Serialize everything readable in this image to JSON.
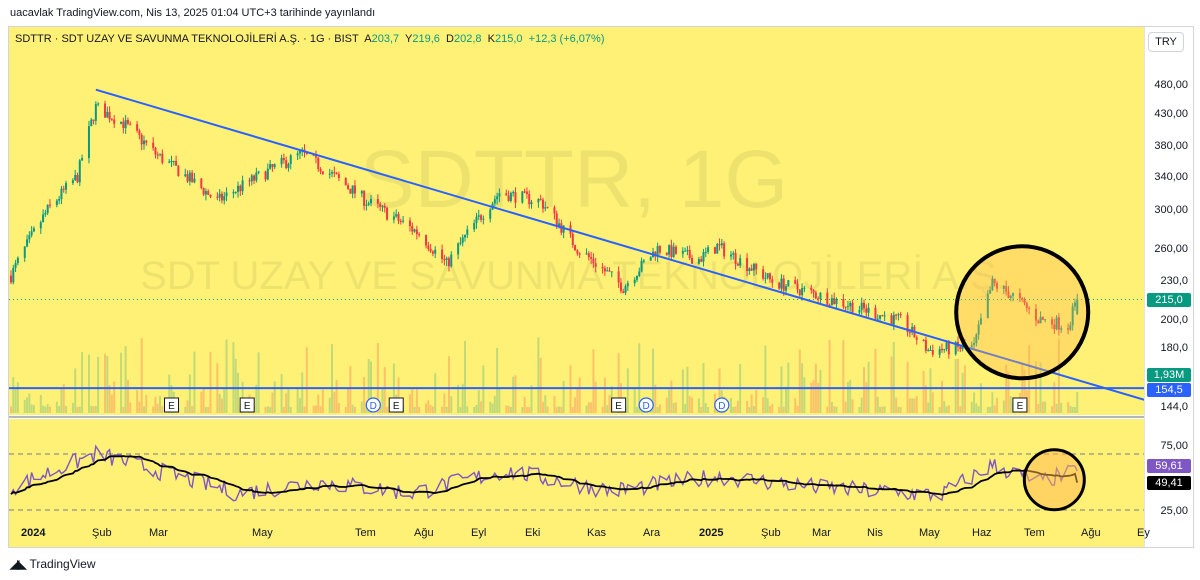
{
  "header": {
    "published": "uacavlak TradingView.com, Nis 13, 2025 01:04 UTC+3 tarihinde yayınlandı"
  },
  "legend": {
    "title": "SDTTR · SDT UZAY VE SAVUNMA TEKNOLOJİLERİ A.Ş. · 1G · BIST",
    "open_label": "A",
    "open": "203,7",
    "high_label": "Y",
    "high": "219,6",
    "low_label": "D",
    "low": "202,8",
    "close_label": "K",
    "close": "215,0",
    "change": "+12,3 (+6,07%)"
  },
  "currency": "TRY",
  "watermark": {
    "line1": "SDTTR, 1G",
    "line2": "SDT UZAY VE SAVUNMA TEKNOLOJİLERİ A.Ş."
  },
  "price_axis": {
    "labels": [
      "480,00",
      "430,00",
      "380,00",
      "340,00",
      "300,00",
      "260,00",
      "230,0",
      "200,0",
      "180,0",
      "144,0"
    ],
    "current_price": "215,0",
    "volume_tag": "1,93M",
    "support_tag": "154,5"
  },
  "rsi_axis": {
    "labels": [
      "75,00",
      "25,00"
    ],
    "rsi_tag": "59,61",
    "ma_tag": "49,41"
  },
  "time_axis": [
    "2024",
    "Şub",
    "Mar",
    "May",
    "Tem",
    "Ağu",
    "Eyl",
    "Eki",
    "Kas",
    "Ara",
    "2025",
    "Şub",
    "Mar",
    "Nis",
    "May",
    "Haz",
    "Tem",
    "Ağu",
    "Ey"
  ],
  "events": [
    "E",
    "E",
    "D",
    "E",
    "E",
    "D",
    "D",
    "E"
  ],
  "footer": {
    "brand": "TradingView"
  },
  "colors": {
    "background": "#fff176",
    "up": "#089981",
    "down": "#f23645",
    "trendline": "#2962ff",
    "rsi": "#7e57c2",
    "circle_fill": "#ffb74d"
  },
  "chart_data": {
    "type": "candlestick",
    "symbol": "SDTTR",
    "interval": "1G",
    "x_range": [
      "2024-01-02",
      "2025-04-11"
    ],
    "ylim": [
      144,
      490
    ],
    "y_scale": "log",
    "anchors": [
      [
        "2024-01-02",
        235
      ],
      [
        "2024-01-18",
        300
      ],
      [
        "2024-01-31",
        340
      ],
      [
        "2024-02-08",
        440
      ],
      [
        "2024-02-20",
        415
      ],
      [
        "2024-03-05",
        370
      ],
      [
        "2024-04-01",
        310
      ],
      [
        "2024-04-25",
        350
      ],
      [
        "2024-05-08",
        370
      ],
      [
        "2024-06-05",
        310
      ],
      [
        "2024-06-28",
        275
      ],
      [
        "2024-07-10",
        245
      ],
      [
        "2024-08-02",
        320
      ],
      [
        "2024-08-20",
        310
      ],
      [
        "2024-09-05",
        260
      ],
      [
        "2024-09-25",
        225
      ],
      [
        "2024-10-10",
        260
      ],
      [
        "2024-10-28",
        250
      ],
      [
        "2024-11-05",
        262
      ],
      [
        "2024-11-29",
        230
      ],
      [
        "2024-12-25",
        215
      ],
      [
        "2025-01-24",
        198
      ],
      [
        "2025-02-05",
        178
      ],
      [
        "2025-02-25",
        180
      ],
      [
        "2025-03-05",
        228
      ],
      [
        "2025-03-14",
        218
      ],
      [
        "2025-03-25",
        200
      ],
      [
        "2025-04-07",
        195
      ],
      [
        "2025-04-11",
        215
      ]
    ],
    "last_bar": {
      "open": 203.7,
      "high": 219.6,
      "low": 202.8,
      "close": 215.0,
      "volume": "1,93M"
    },
    "trendline": {
      "from": [
        "2024-02-08",
        470
      ],
      "to": [
        "2025-06-01",
        140
      ]
    },
    "support_level": 154.5,
    "highlight_circles": [
      {
        "center_date": "2025-03-18",
        "center_price": 205
      },
      {
        "center_date": "2025-04-01",
        "indicator": "rsi",
        "center_value": 52
      }
    ],
    "rsi": {
      "levels": [
        75,
        25
      ],
      "last_rsi": 59.61,
      "last_ma": 49.41,
      "anchors": [
        [
          "2024-01-02",
          45
        ],
        [
          "2024-02-08",
          75
        ],
        [
          "2024-03-15",
          55
        ],
        [
          "2024-04-10",
          40
        ],
        [
          "2024-05-15",
          50
        ],
        [
          "2024-06-25",
          40
        ],
        [
          "2024-08-05",
          60
        ],
        [
          "2024-09-20",
          42
        ],
        [
          "2024-11-05",
          55
        ],
        [
          "2024-12-20",
          45
        ],
        [
          "2025-02-10",
          38
        ],
        [
          "2025-03-05",
          65
        ],
        [
          "2025-03-25",
          50
        ],
        [
          "2025-04-11",
          59.61
        ]
      ]
    }
  }
}
